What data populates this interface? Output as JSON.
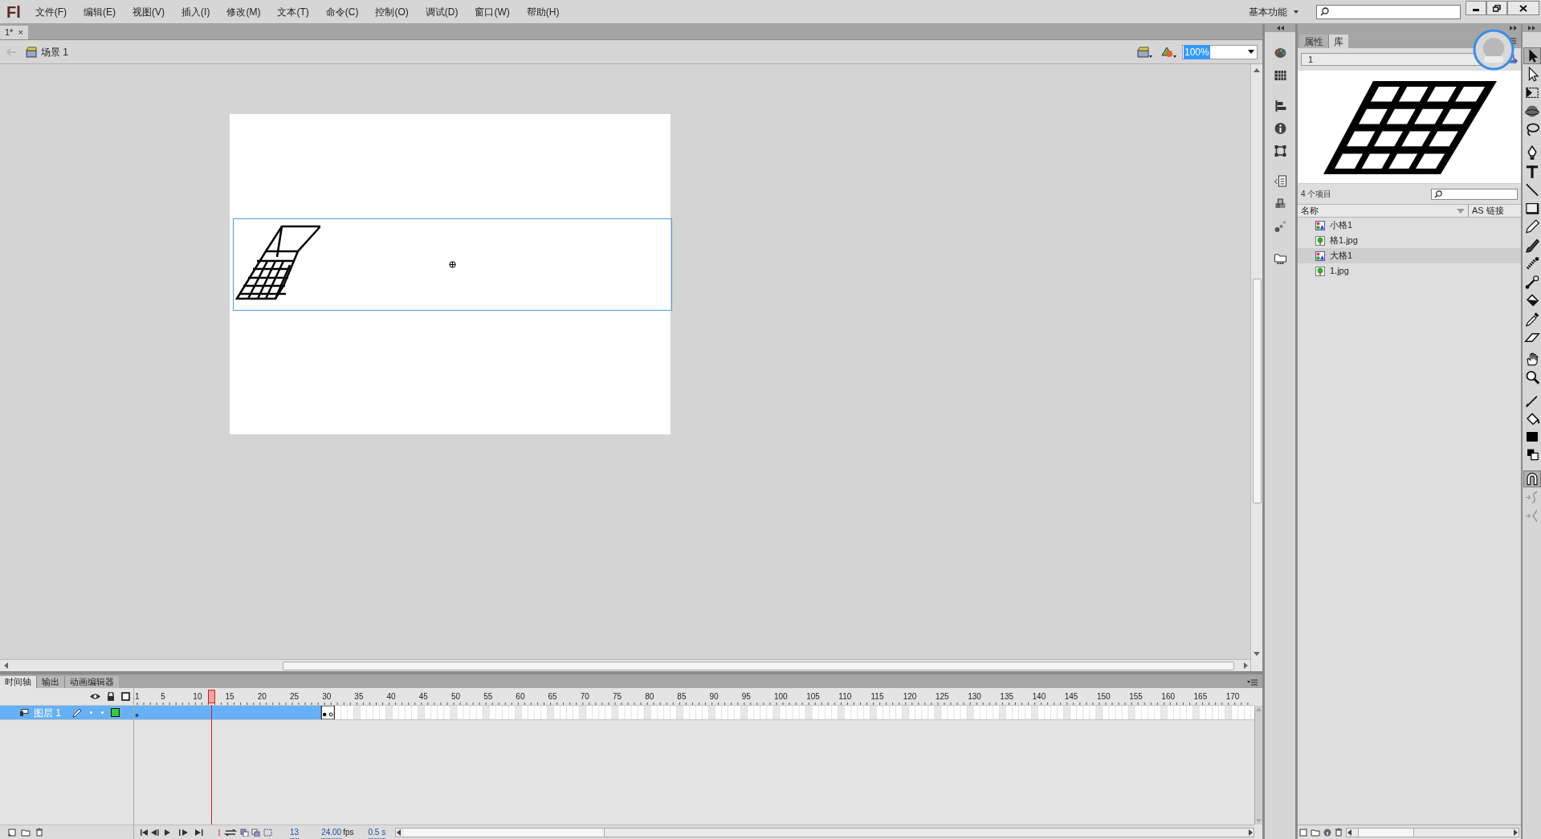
{
  "app": {
    "logo": "Fl",
    "menu": [
      "文件(F)",
      "编辑(E)",
      "视图(V)",
      "插入(I)",
      "修改(M)",
      "文本(T)",
      "命令(C)",
      "控制(O)",
      "调试(D)",
      "窗口(W)",
      "帮助(H)"
    ],
    "workspace": "基本功能"
  },
  "document_tabs": [
    {
      "label": "1*",
      "close": "×",
      "selected": true
    }
  ],
  "edit_bar": {
    "scene": "场景 1",
    "zoom": "100%"
  },
  "library": {
    "tabs": [
      {
        "label": "属性",
        "selected": false
      },
      {
        "label": "库",
        "selected": true
      }
    ],
    "document": "1",
    "item_count": "4 个项目",
    "columns": [
      "名称",
      "AS 链接"
    ],
    "items": [
      {
        "name": "小格1",
        "kind": "symbol",
        "selected": false
      },
      {
        "name": "格1.jpg",
        "kind": "bitmap",
        "selected": false
      },
      {
        "name": "大格1",
        "kind": "symbol",
        "selected": true
      },
      {
        "name": "1.jpg",
        "kind": "bitmap",
        "selected": false
      }
    ]
  },
  "timeline": {
    "tabs": [
      {
        "label": "时间轴",
        "selected": true
      },
      {
        "label": "输出",
        "selected": false
      },
      {
        "label": "动画编辑器",
        "selected": false
      }
    ],
    "ruler": [
      "1",
      "5",
      "10",
      "15",
      "20",
      "25",
      "30",
      "35",
      "40",
      "45",
      "50",
      "55",
      "60",
      "65",
      "70",
      "75",
      "80",
      "85",
      "90",
      "95",
      "100",
      "105",
      "110",
      "115",
      "120",
      "125",
      "130",
      "135",
      "140",
      "145",
      "150",
      "155",
      "160",
      "165",
      "170"
    ],
    "layers": [
      {
        "name": "图层 1",
        "selected": true,
        "color": "#33cc33"
      }
    ],
    "current_frame": "13",
    "fps": "24.00",
    "fps_unit": "fps",
    "elapsed": "0.5 s"
  },
  "tools": [
    {
      "kind": "arrow",
      "selected": true
    },
    {
      "kind": "subselect",
      "selected": false
    },
    {
      "kind": "transform",
      "selected": false
    },
    {
      "kind": "sphere",
      "selected": false
    },
    {
      "kind": "lasso",
      "selected": false
    },
    {
      "kind": "pen",
      "selected": false
    },
    {
      "kind": "text",
      "selected": false
    },
    {
      "kind": "line",
      "selected": false
    },
    {
      "kind": "rect",
      "selected": false
    },
    {
      "kind": "pencil",
      "selected": false
    },
    {
      "kind": "brush",
      "selected": false
    },
    {
      "kind": "spray",
      "selected": false
    },
    {
      "kind": "bone",
      "selected": false
    },
    {
      "kind": "bucket",
      "selected": false
    },
    {
      "kind": "dropper",
      "selected": false
    },
    {
      "kind": "eraser",
      "selected": false
    },
    {
      "kind": "hand",
      "selected": false
    },
    {
      "kind": "zoom",
      "selected": false
    },
    {
      "kind": "stroke",
      "selected": false
    },
    {
      "kind": "fillbucket",
      "selected": false
    },
    {
      "kind": "swatch",
      "selected": false
    },
    {
      "kind": "swap",
      "selected": false
    },
    {
      "kind": "snap",
      "selected": true
    },
    {
      "kind": "smooth",
      "selected": false
    },
    {
      "kind": "straighten",
      "selected": false
    }
  ]
}
